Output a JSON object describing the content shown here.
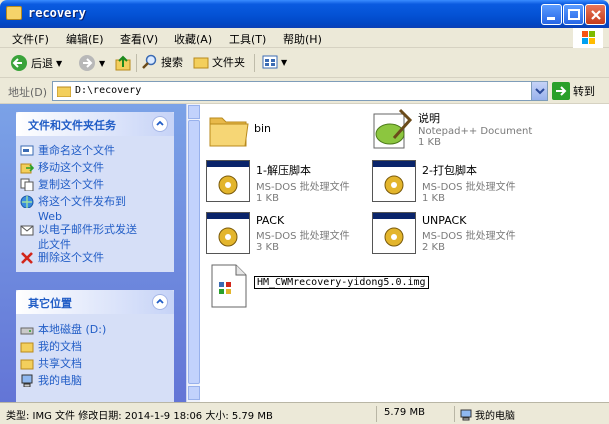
{
  "window": {
    "title": "recovery"
  },
  "menu": [
    "文件(F)",
    "编辑(E)",
    "查看(V)",
    "收藏(A)",
    "工具(T)",
    "帮助(H)"
  ],
  "toolbar": {
    "back": "后退",
    "search": "搜索",
    "folders": "文件夹"
  },
  "address": {
    "label": "地址(D)",
    "value": "D:\\recovery",
    "go": "转到"
  },
  "tasks_panel": {
    "title": "文件和文件夹任务",
    "items": [
      {
        "label": "重命名这个文件",
        "icon": "rename-icon"
      },
      {
        "label": "移动这个文件",
        "icon": "move-icon"
      },
      {
        "label": "复制这个文件",
        "icon": "copy-icon"
      },
      {
        "label": "将这个文件发布到",
        "label2": "Web",
        "icon": "publish-web-icon"
      },
      {
        "label": "以电子邮件形式发送",
        "label2": "此文件",
        "icon": "email-icon"
      },
      {
        "label": "删除这个文件",
        "icon": "delete-icon"
      }
    ]
  },
  "places_panel": {
    "title": "其它位置",
    "items": [
      {
        "label": "本地磁盘 (D:)",
        "icon": "local-disk-icon"
      },
      {
        "label": "我的文档",
        "icon": "my-documents-icon"
      },
      {
        "label": "共享文档",
        "icon": "shared-documents-icon"
      },
      {
        "label": "我的电脑",
        "icon": "my-computer-icon"
      }
    ]
  },
  "files": [
    {
      "name": "bin",
      "type": "",
      "size": "",
      "icon": "folder-icon"
    },
    {
      "name": "说明",
      "type": "Notepad++ Document",
      "size": "1 KB",
      "icon": "notepad-icon"
    },
    {
      "name": "1-解压脚本",
      "type": "MS-DOS 批处理文件",
      "size": "1 KB",
      "icon": "batch-file-icon"
    },
    {
      "name": "2-打包脚本",
      "type": "MS-DOS 批处理文件",
      "size": "1 KB",
      "icon": "batch-file-icon"
    },
    {
      "name": "PACK",
      "type": "MS-DOS 批处理文件",
      "size": "3 KB",
      "icon": "batch-file-icon"
    },
    {
      "name": "UNPACK",
      "type": "MS-DOS 批处理文件",
      "size": "2 KB",
      "icon": "batch-file-icon"
    },
    {
      "name": "HM_CWMrecovery-yidong5.0.img",
      "type": "",
      "size": "",
      "icon": "img-file-icon"
    }
  ],
  "status": {
    "info": "类型: IMG 文件 修改日期: 2014-1-9 18:06 大小: 5.79 MB",
    "size": "5.79 MB",
    "location": "我的电脑"
  }
}
